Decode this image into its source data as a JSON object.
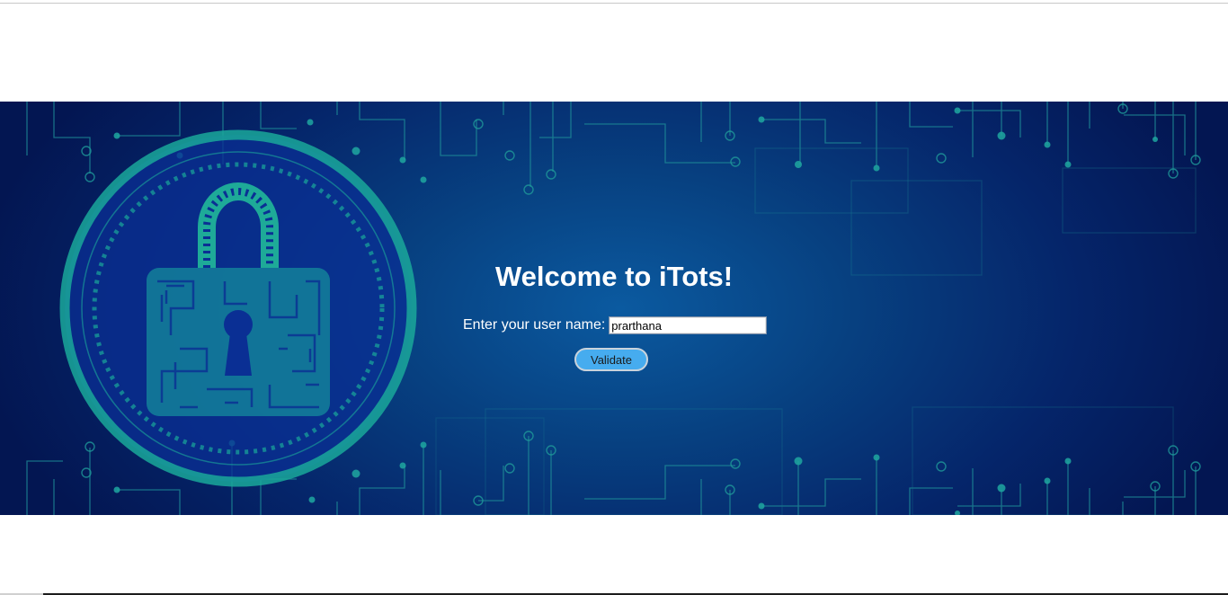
{
  "page": {
    "heading": "Welcome to iTots!",
    "prompt_label": "Enter your user name:",
    "username_value": "prarthana",
    "validate_label": "Validate"
  },
  "theme": {
    "banner_dark": "#031652",
    "banner_mid": "#074181",
    "banner_light": "#0b5aa0",
    "circuit_color": "#1f9a9a",
    "button_color": "#46acef"
  },
  "icons": {
    "hero_graphic": "padlock-circuit-icon"
  }
}
